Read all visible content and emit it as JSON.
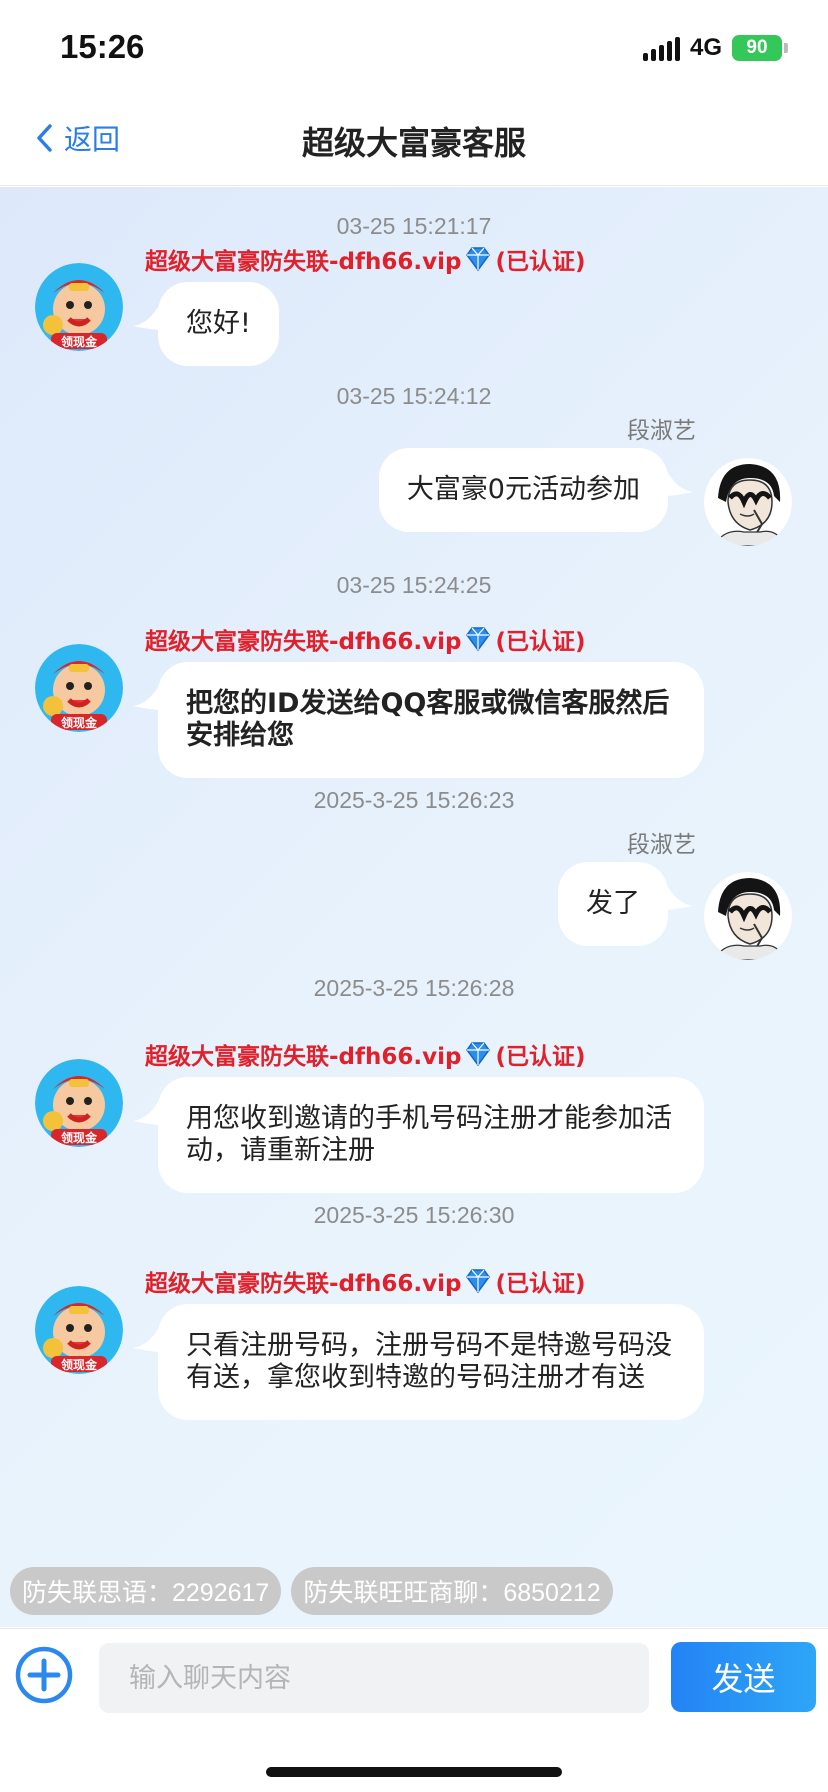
{
  "status": {
    "time": "15:26",
    "network": "4G",
    "battery": "90"
  },
  "nav": {
    "back_label": "返回",
    "title": "超级大富豪客服"
  },
  "agent": {
    "name": "超级大富豪防失联-dfh66.vip",
    "verified": "(已认证)",
    "avatar_badge": "领现金"
  },
  "user": {
    "name": "段淑艺"
  },
  "messages": [
    {
      "time": "03-25 15:21:17",
      "from": "agent",
      "text": "您好!"
    },
    {
      "time": "03-25 15:24:12",
      "from": "user",
      "text": "大富豪0元活动参加"
    },
    {
      "time": "03-25 15:24:25",
      "from": "agent",
      "text": "把您的ID发送给QQ客服或微信客服然后安排给您"
    },
    {
      "time": "2025-3-25 15:26:23",
      "from": "user",
      "text": "发了"
    },
    {
      "time": "2025-3-25 15:26:28",
      "from": "agent",
      "text": "用您收到邀请的手机号码注册才能参加活动，请重新注册"
    },
    {
      "time": "2025-3-25 15:26:30",
      "from": "agent",
      "text": "只看注册号码，注册号码不是特邀号码没有送，拿您收到特邀的号码注册才有送"
    }
  ],
  "quick_chips": [
    "防失联思语：2292617",
    "防失联旺旺商聊：6850212"
  ],
  "input": {
    "placeholder": "输入聊天内容",
    "value": ""
  },
  "send_label": "发送",
  "colors": {
    "accent": "#2a7ee6",
    "agent_name": "#e0212b",
    "battery": "#34c759",
    "send": "#2383f5"
  }
}
